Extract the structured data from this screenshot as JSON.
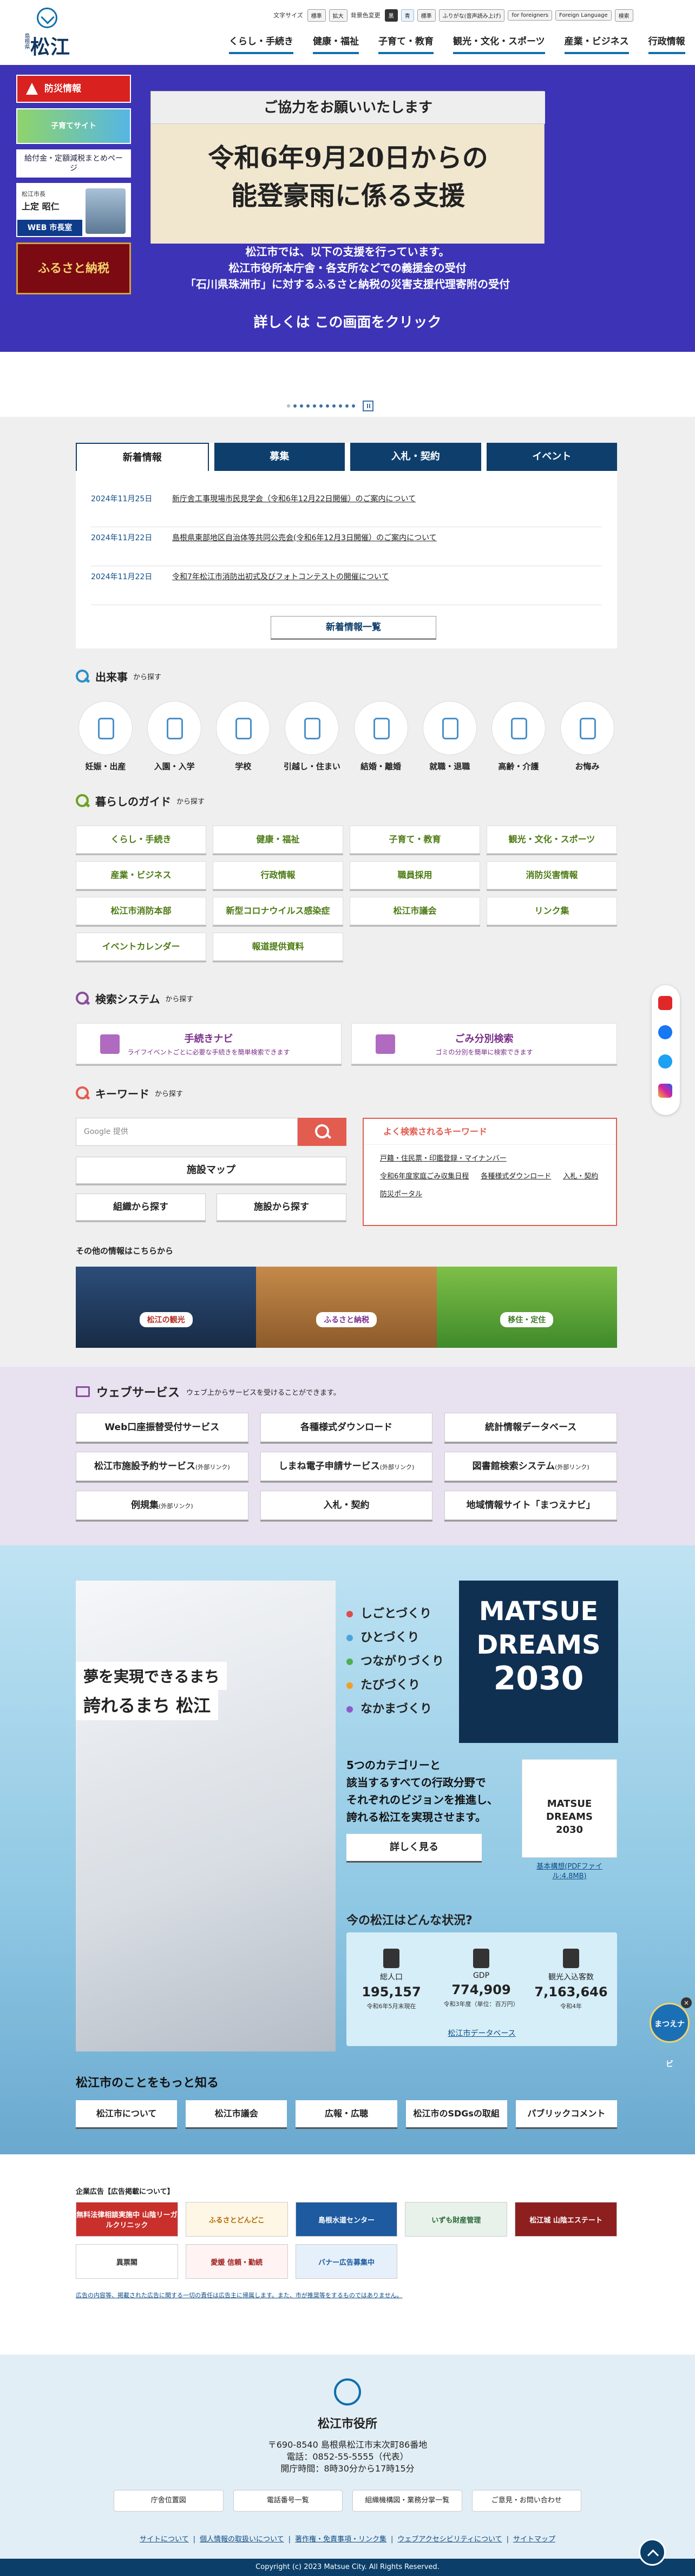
{
  "header": {
    "logo_small": "島根県",
    "logo_text": "松江市",
    "util": {
      "text_size_label": "文字サイズ",
      "text_size_options": [
        "標準",
        "拡大"
      ],
      "bg_color_label": "背景色変更",
      "bg_color_options": [
        "黒",
        "青",
        "標準"
      ],
      "ruby": "ふりがな(音声読み上げ)",
      "foreigners": "for foreigners",
      "language": "Foreign Language",
      "search": "検索"
    },
    "nav": [
      "くらし・手続き",
      "健康・福祉",
      "子育て・教育",
      "観光・文化・スポーツ",
      "産業・ビジネス",
      "行政情報"
    ]
  },
  "hero": {
    "side": {
      "disaster": "防災情報",
      "kids": "子育てサイト",
      "pay": "給付金・定額減税まとめページ",
      "mayor_small": "松江市長",
      "mayor_name": "上定 昭仁",
      "mayor_web": "WEB 市長室",
      "furusato": "ふるさと納税"
    },
    "card_head": "ご協力をお願いいたします",
    "card_big": [
      "令和6年9月20日からの",
      "能登豪雨に係る支援"
    ],
    "sub": [
      "松江市では、以下の支援を行っています。",
      "松江市役所本庁舎・各支所などでの義援金の受付",
      "「石川県珠洲市」に対するふるさと納税の災害支援代理寄附の受付"
    ],
    "cta": "詳しくは この画面をクリック"
  },
  "news": {
    "tabs": [
      "新着情報",
      "募集",
      "入札・契約",
      "イベント"
    ],
    "items": [
      {
        "date": "2024年11月25日",
        "title": "新庁舎工事現場市民見学会（令和6年12月22日開催）のご案内について"
      },
      {
        "date": "2024年11月22日",
        "title": "島根県東部地区自治体等共同公売会(令和6年12月3日開催）のご案内について"
      },
      {
        "date": "2024年11月22日",
        "title": "令和7年松江市消防出初式及びフォトコンテストの開催について"
      }
    ],
    "more": "新着情報一覧"
  },
  "events": {
    "title": "出来事",
    "suffix": "から探す",
    "items": [
      "妊娠・出産",
      "入園・入学",
      "学校",
      "引越し・住まい",
      "結婚・離婚",
      "就職・退職",
      "高齢・介護",
      "お悔み"
    ]
  },
  "guide": {
    "title": "暮らしのガイド",
    "suffix": "から探す",
    "items": [
      "くらし・手続き",
      "健康・福祉",
      "子育て・教育",
      "観光・文化・スポーツ",
      "産業・ビジネス",
      "行政情報",
      "職員採用",
      "消防災害情報",
      "松江市消防本部",
      "新型コロナウイルス感染症",
      "松江市議会",
      "リンク集",
      "イベントカレンダー",
      "報道提供資料"
    ]
  },
  "systems": {
    "title": "検索システム",
    "suffix": "から探す",
    "items": [
      {
        "title": "手続きナビ",
        "sub": "ライフイベントごとに必要な手続きを簡単検索できます"
      },
      {
        "title": "ごみ分別検索",
        "sub": "ゴミの分別を簡単に検索できます"
      }
    ]
  },
  "keyword": {
    "title": "キーワード",
    "suffix": "から探す",
    "placeholder": "Google 提供",
    "map": "施設マップ",
    "org": "組織から探す",
    "facility": "施設から探す",
    "popular_title": "よく検索されるキーワード",
    "popular": [
      "戸籍・住民票・印鑑登録・マイナンバー",
      "令和6年度家庭ごみ収集日程",
      "各種様式ダウンロード",
      "入札・契約",
      "防災ポータル"
    ]
  },
  "other": {
    "label": "その他の情報はこちらから",
    "banners": [
      "松江の観光",
      "ふるさと納税",
      "移住・定住"
    ]
  },
  "webservice": {
    "title": "ウェブサービス",
    "sub": "ウェブ上からサービスを受けることができます。",
    "items": [
      {
        "label": "Web口座振替受付サービス",
        "note": ""
      },
      {
        "label": "各種様式ダウンロード",
        "note": ""
      },
      {
        "label": "統計情報データベース",
        "note": ""
      },
      {
        "label": "松江市施設予約サービス",
        "note": "(外部リンク)"
      },
      {
        "label": "しまね電子申請サービス",
        "note": "(外部リンク)"
      },
      {
        "label": "図書館検索システム",
        "note": "(外部リンク)"
      },
      {
        "label": "例規集",
        "note": "(外部リンク)"
      },
      {
        "label": "入札・契約",
        "note": ""
      },
      {
        "label": "地域情報サイト「まつえナビ」",
        "note": ""
      }
    ]
  },
  "dreams": {
    "photo_t1": "夢を実現できるまち",
    "photo_t2": "誇れるまち 松江",
    "pillars": [
      {
        "label": "しごとづくり",
        "color": "#e04b4b"
      },
      {
        "label": "ひとづくり",
        "color": "#4aa5d9"
      },
      {
        "label": "つながりづくり",
        "color": "#4caf50"
      },
      {
        "label": "たびづくり",
        "color": "#f0a020"
      },
      {
        "label": "なかまづくり",
        "color": "#8e5ac8"
      }
    ],
    "logo": [
      "MATSUE",
      "DREAMS",
      "2030"
    ],
    "text": [
      "5つのカテゴリーと",
      "該当するすべての行政分野で",
      "それぞれのビジョンを推進し、",
      "誇れる松江を実現させます。"
    ],
    "book": [
      "MATSUE",
      "DREAMS",
      "2030"
    ],
    "book_link": "基本構想(PDFファイル:4.8MB)",
    "detail": "詳しく見る",
    "now_title": "今の松江はどんな状況?",
    "stats": [
      {
        "label": "総人口",
        "value": "195,157",
        "note": "令和6年5月末現在"
      },
      {
        "label": "GDP",
        "value": "774,909",
        "note": "令和3年度（単位：百万円）"
      },
      {
        "label": "観光入込客数",
        "value": "7,163,646",
        "note": "令和4年"
      }
    ],
    "now_link": "松江市データベース"
  },
  "more": {
    "title": "松江市のことをもっと知る",
    "items": [
      "松江市について",
      "松江市議会",
      "広報・広聴",
      "松江市のSDGsの取組",
      "パブリックコメント"
    ]
  },
  "ads": {
    "title": "企業広告【広告掲載について】",
    "items": [
      "無料法律相談実施中 山陰リーガルクリニック",
      "ふるさとどんどこ",
      "島根水道センター",
      "いずも財産管理",
      "松江城 山陰エステート",
      "異票閣",
      "愛媛 信頼・勤続",
      "バナー広告募集中"
    ],
    "note": "広告の内容等、掲載された広告に関する一切の責任は広告主に帰属します。また、市が推奨等をするものではありません。"
  },
  "footer": {
    "name": "松江市役所",
    "address": [
      "〒690-8540 島根県松江市末次町86番地",
      "電話：0852-55-5555（代表）",
      "開庁時間：8時30分から17時15分"
    ],
    "buttons": [
      "庁舎位置図",
      "電話番号一覧",
      "組織機構図・業務分掌一覧",
      "ご意見・お問い合わせ"
    ],
    "links": [
      "サイトについて",
      "個人情報の取扱いについて",
      "著作権・免責事項・リンク集",
      "ウェブアクセシビリティについて",
      "サイトマップ"
    ],
    "copyright": "Copyright (c) 2023 Matsue City. All Rights Reserved."
  },
  "mascot": "まつえナビ"
}
